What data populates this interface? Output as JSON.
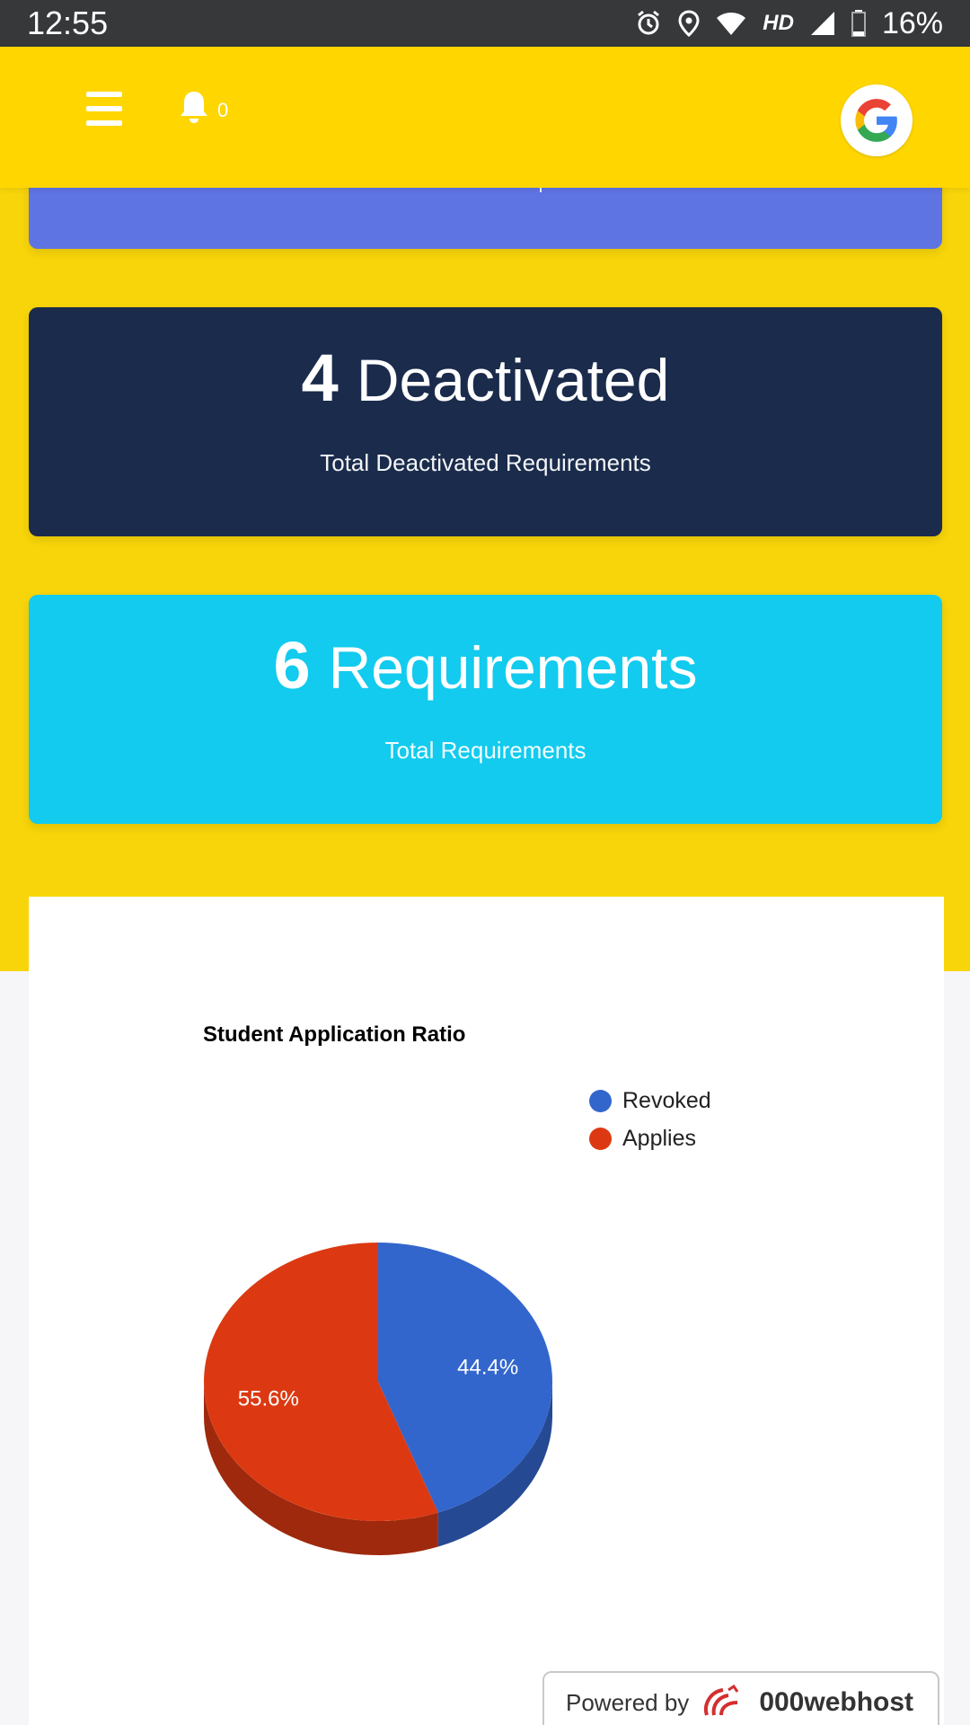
{
  "status_bar": {
    "time": "12:55",
    "network": "HD",
    "battery": "16%"
  },
  "app_bar": {
    "notification_count": "0"
  },
  "cards": {
    "deactivated": {
      "count": "4",
      "label": "Deactivated",
      "subtitle": "Total Deactivated Requirements"
    },
    "total": {
      "count": "6",
      "label": "Requirements",
      "subtitle": "Total Requirements"
    }
  },
  "chart_data": {
    "type": "pie",
    "title": "Student Application Ratio",
    "slices": [
      {
        "name": "Revoked",
        "value": 44.4,
        "label": "44.4%",
        "color": "#3366cc"
      },
      {
        "name": "Applies",
        "value": 55.6,
        "label": "55.6%",
        "color": "#dc3912"
      }
    ],
    "legend_position": "top-right",
    "style": "3d"
  },
  "footer": {
    "powered_by": "Powered by",
    "brand": "000webhost"
  },
  "colors": {
    "app_bar": "#ffd600",
    "page_yellow": "#f7d50a",
    "card_partial": "#5e74e2",
    "card_deactivated": "#1a2b4c",
    "card_total": "#12cbee"
  }
}
